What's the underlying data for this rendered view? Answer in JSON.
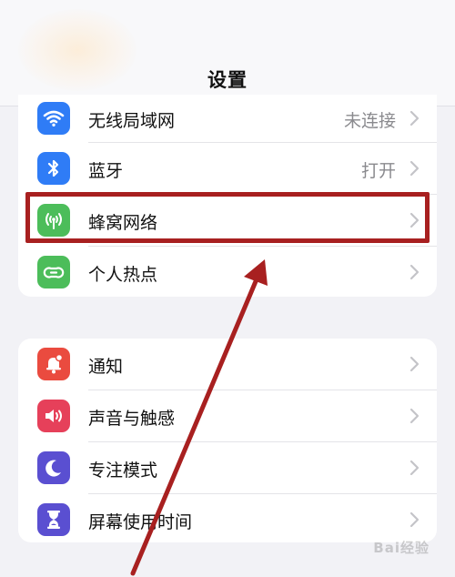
{
  "header": {
    "title": "设置"
  },
  "group1": {
    "items": [
      {
        "label": "无线局域网",
        "value": "未连接",
        "icon": "wifi-icon",
        "color": "#2f7cf6"
      },
      {
        "label": "蓝牙",
        "value": "打开",
        "icon": "bluetooth-icon",
        "color": "#2f7cf6"
      },
      {
        "label": "蜂窝网络",
        "value": "",
        "icon": "cellular-icon",
        "color": "#4cbd5a"
      },
      {
        "label": "个人热点",
        "value": "",
        "icon": "hotspot-icon",
        "color": "#4cbd5a"
      }
    ]
  },
  "group2": {
    "items": [
      {
        "label": "通知",
        "value": "",
        "icon": "notification-bell-icon",
        "color": "#ea4b3f"
      },
      {
        "label": "声音与触感",
        "value": "",
        "icon": "speaker-icon",
        "color": "#e6405a"
      },
      {
        "label": "专注模式",
        "value": "",
        "icon": "moon-icon",
        "color": "#5a4fd1"
      },
      {
        "label": "屏幕使用时间",
        "value": "",
        "icon": "hourglass-icon",
        "color": "#5a4fd1"
      }
    ]
  },
  "annotation": {
    "highlight_color": "#a82020"
  },
  "watermark": {
    "text": "Bai经验"
  }
}
